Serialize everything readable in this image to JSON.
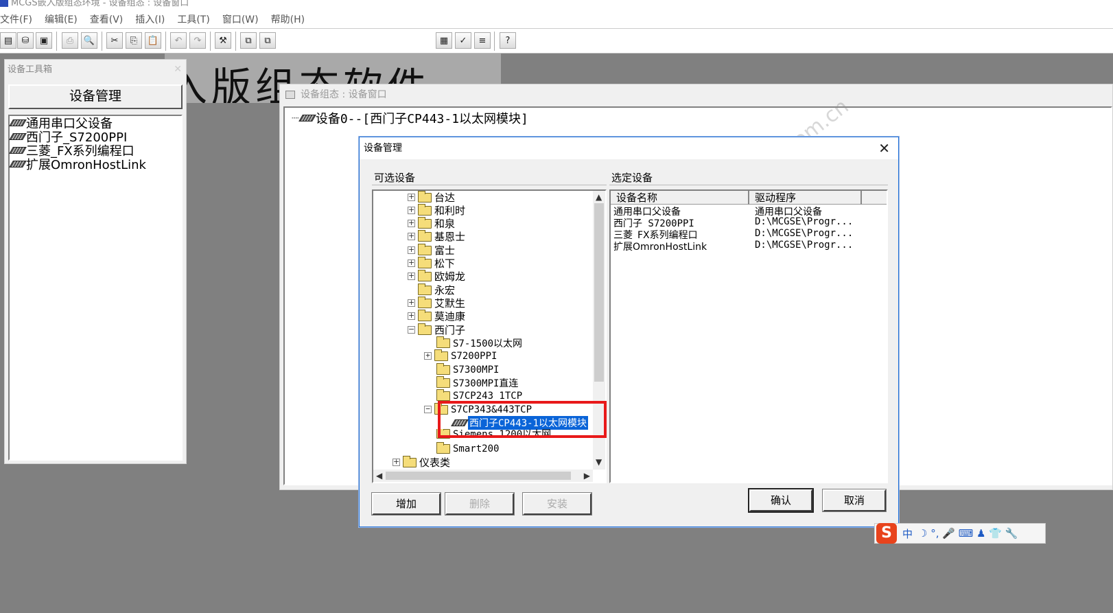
{
  "app": {
    "title": "MCGS嵌入版组态环境 - 设备组态 : 设备窗口"
  },
  "menu": [
    "文件(F)",
    "编辑(E)",
    "查看(V)",
    "插入(I)",
    "工具(T)",
    "窗口(W)",
    "帮助(H)"
  ],
  "background_banner": "嵌入版组态软件",
  "toolbox": {
    "title": "设备工具箱",
    "button": "设备管理",
    "items": [
      "通用串口父设备",
      "西门子_S7200PPI",
      "三菱_FX系列编程口",
      "扩展OmronHostLink"
    ]
  },
  "device_window": {
    "title": "设备组态 : 设备窗口",
    "node": "设备0--[西门子CP443-1以太网模块]"
  },
  "dialog": {
    "title": "设备管理",
    "available_label": "可选设备",
    "selected_label": "选定设备",
    "tree": [
      "台达",
      "和利时",
      "和泉",
      "基恩士",
      "富士",
      "松下",
      "欧姆龙",
      "永宏",
      "艾默生",
      "莫迪康",
      "西门子",
      "S7-1500以太网",
      "S7200PPI",
      "S7300MPI",
      "S7300MPI直连",
      "S7CP243_1TCP",
      "S7CP343&443TCP",
      "西门子CP443-1以太网模块",
      "Siemens_1200以太网",
      "Smart200",
      "仪表类"
    ],
    "columns": [
      "设备名称",
      "驱动程序"
    ],
    "rows": [
      {
        "name": "通用串口父设备",
        "driver": "通用串口父设备"
      },
      {
        "name": "西门子_S7200PPI",
        "driver": "D:\\MCGSE\\Progr..."
      },
      {
        "name": "三菱_FX系列编程口",
        "driver": "D:\\MCGSE\\Progr..."
      },
      {
        "name": "扩展OmronHostLink",
        "driver": "D:\\MCGSE\\Progr..."
      }
    ],
    "buttons": {
      "add": "增加",
      "delete": "删除",
      "install": "安装",
      "ok": "确认",
      "cancel": "取消"
    }
  },
  "ime": {
    "logo": "S",
    "mode": "中",
    "icons": "☽ °, 🎤 ⌨ ♟ 👕 🔧"
  },
  "watermark": "西门子工业 技术论坛 industry.siemens.com.cn"
}
